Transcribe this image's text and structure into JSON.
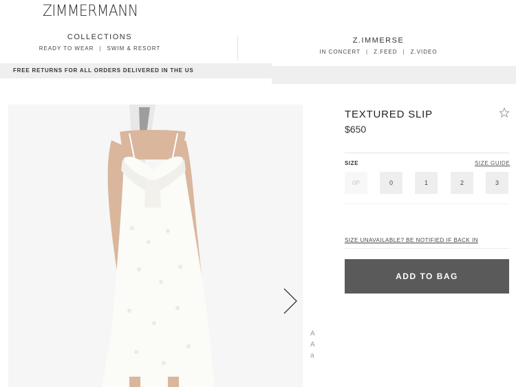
{
  "brand": {
    "logo": "ZIMMERMANN"
  },
  "nav": {
    "left": {
      "title": "COLLECTIONS",
      "links": [
        "READY TO WEAR",
        "SWIM & RESORT"
      ]
    },
    "right": {
      "title": "Z.IMMERSE",
      "links": [
        "IN CONCERT",
        "Z.FEED",
        "Z.VIDEO"
      ]
    },
    "separator": "|"
  },
  "promo": {
    "text": "FREE RETURNS FOR ALL ORDERS DELIVERED IN THE US"
  },
  "gallery": {
    "image_alt": "White textured slip dress",
    "next_icon": "chevron-right-icon",
    "edge_glyphs": [
      "A",
      "A",
      "a"
    ]
  },
  "product": {
    "title": "TEXTURED SLIP",
    "price": "$650",
    "wishlist_icon": "star-outline-icon"
  },
  "size": {
    "label": "SIZE",
    "guide_label": "SIZE GUIDE",
    "options": [
      {
        "label": "0P",
        "available": false
      },
      {
        "label": "0",
        "available": true
      },
      {
        "label": "1",
        "available": true
      },
      {
        "label": "2",
        "available": true
      },
      {
        "label": "3",
        "available": true
      }
    ],
    "notify_text": "SIZE UNAVAILABLE? BE NOTIFIED IF BACK IN"
  },
  "cta": {
    "add_to_bag": "ADD TO BAG"
  },
  "colors": {
    "button_bg": "#5a5a5a",
    "promo_bg": "#efefef",
    "size_bg": "#eeeeee"
  }
}
